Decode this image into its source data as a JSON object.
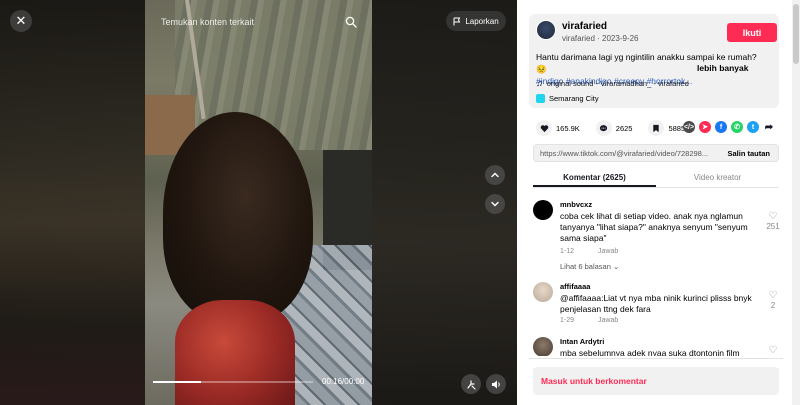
{
  "video": {
    "search_placeholder": "Temukan konten terkait",
    "report_label": "Laporkan",
    "time": "00:16/00:00",
    "progress": 0.3
  },
  "author": {
    "display_name": "virafaried",
    "handle": "virafaried",
    "date": "2023-9-26",
    "follow_label": "Ikuti"
  },
  "caption": {
    "text": "Hantu darimana lagi yg ngintilin anakku sampai ke rumah? 😣",
    "tags": "#indigo #anakindigo #creepy #horrortok...",
    "more_label": "lebih banyak"
  },
  "sound": {
    "icon": "music-note-icon",
    "text": "original sound - Viraramadhan_ - virafaried"
  },
  "location": "Semarang City",
  "stats": {
    "likes": "165.9K",
    "comments": "2625",
    "saves": "5885"
  },
  "share": {
    "link": "https://www.tiktok.com/@virafaried/video/728298...",
    "copy_label": "Salin tautan",
    "colors": {
      "embed": "#4a4a4a",
      "direct": "#fe2c55",
      "facebook": "#1877f2",
      "whatsapp": "#25d366",
      "twitter": "#1da1f2",
      "forward": "#161823"
    }
  },
  "tabs": [
    {
      "label": "Komentar (2625)",
      "active": true
    },
    {
      "label": "Video kreator",
      "active": false
    }
  ],
  "comments": [
    {
      "user": "mnbvcxz",
      "text": "coba cek lihat di setiap video. anak nya nglamun tanyanya \"lihat siapa?\" anaknya senyum \"senyum sama siapa\"",
      "date": "1-12",
      "reply_label": "Jawab",
      "likes": "251",
      "replies_label": "Lihat 6 balasan"
    },
    {
      "user": "affifaaaa",
      "text": "@affifaaaa:Liat vt nya mba ninik kurinci plisss bnyk penjelasan ttng dek fara",
      "date": "1-29",
      "reply_label": "Jawab",
      "likes": "2"
    },
    {
      "user": "Intan Ardytri",
      "text": "mba sebelumnya adek nyaa suka dtontonin film"
    }
  ],
  "login_comment_label": "Masuk untuk berkomentar",
  "accent": "#fe2c55"
}
